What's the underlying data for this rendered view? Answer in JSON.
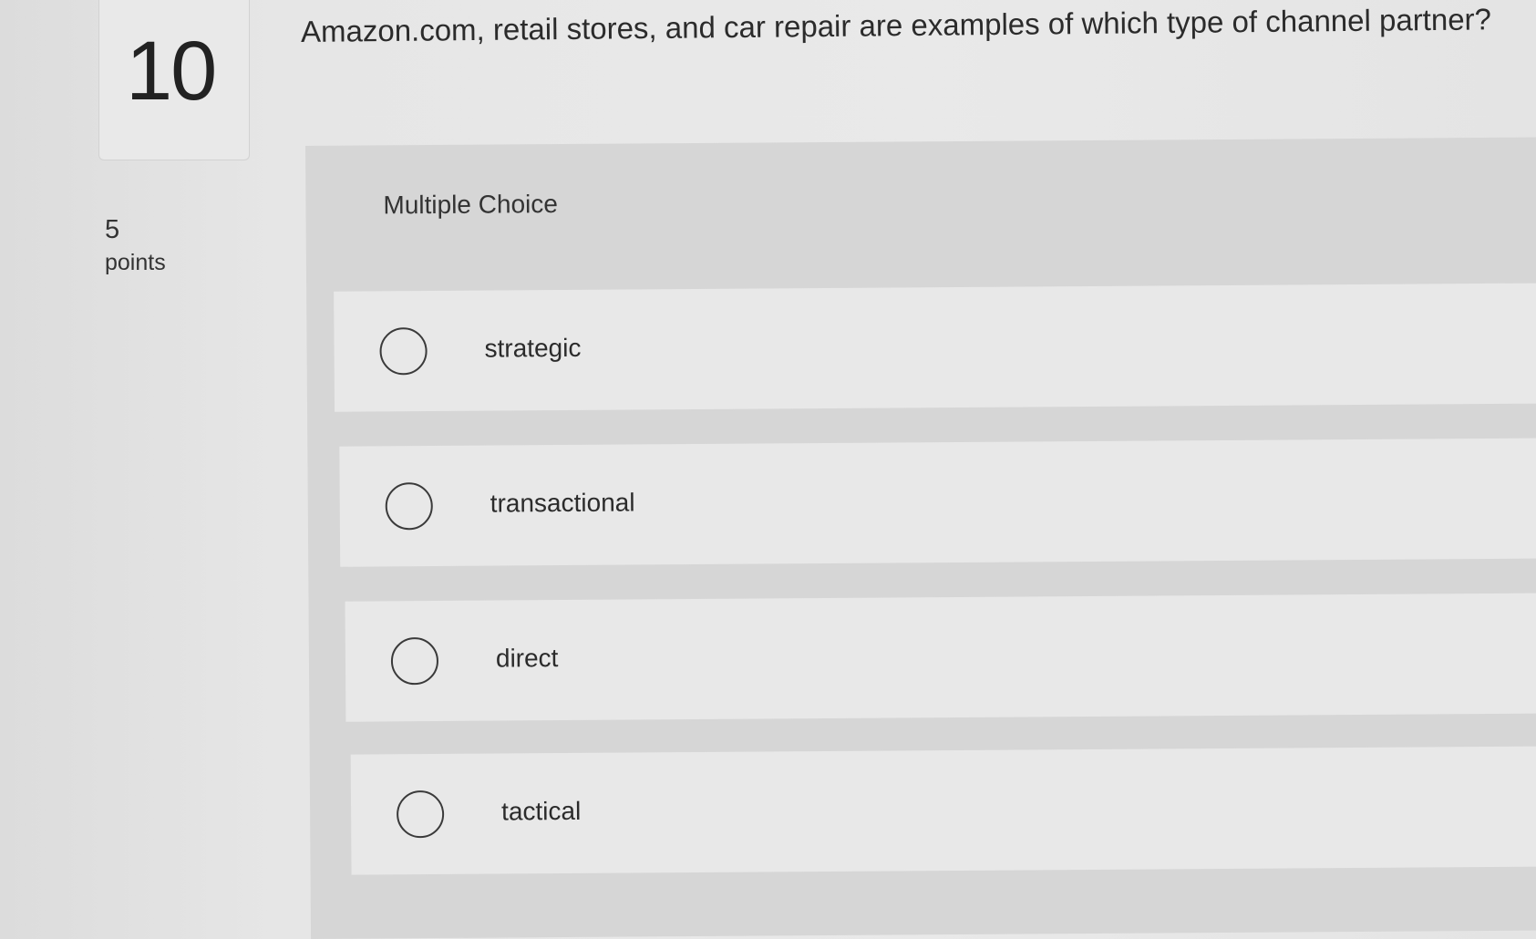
{
  "question": {
    "number": "10",
    "text": "Amazon.com, retail stores, and car repair are examples of which type of channel partner?",
    "points_value": "5",
    "points_label": "points",
    "type_label": "Multiple Choice"
  },
  "options": [
    {
      "label": "strategic"
    },
    {
      "label": "transactional"
    },
    {
      "label": "direct"
    },
    {
      "label": "tactical"
    }
  ],
  "colors": {
    "background": "#e6e6e6",
    "panel": "#d6d6d6",
    "option_card": "#e8e8e8",
    "text": "#2b2b2b"
  }
}
